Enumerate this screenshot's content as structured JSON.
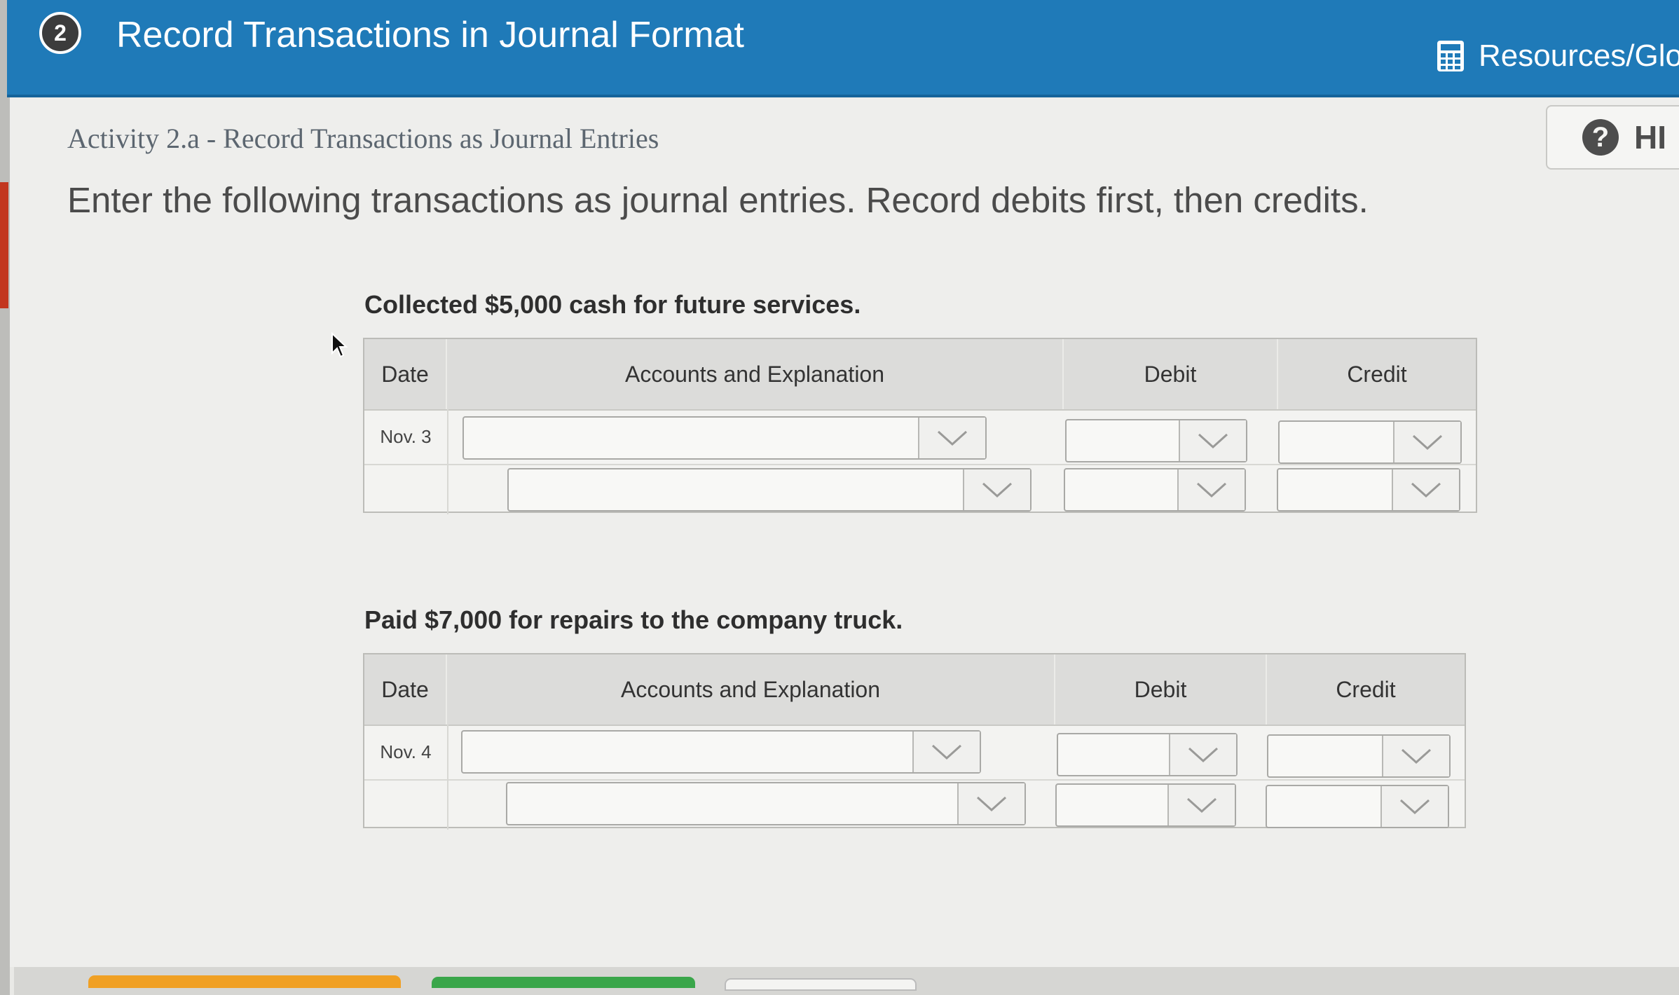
{
  "header": {
    "step_number": "2",
    "title": "Record Transactions in Journal Format",
    "resources_label": "Resources/Glos",
    "accent_color": "#1f7ab8"
  },
  "hint": {
    "icon": "question-circle-icon",
    "label": "HI"
  },
  "activity": {
    "subtitle": "Activity 2.a - Record Transactions as Journal Entries",
    "instructions": "Enter the following transactions as journal entries. Record debits first, then credits."
  },
  "journal_headers": {
    "date": "Date",
    "accounts": "Accounts and Explanation",
    "debit": "Debit",
    "credit": "Credit"
  },
  "transactions": [
    {
      "description": "Collected $5,000 cash for future services.",
      "rows": [
        {
          "date": "Nov. 3",
          "account": "",
          "debit": "",
          "credit": ""
        },
        {
          "date": "",
          "account": "",
          "debit": "",
          "credit": ""
        }
      ]
    },
    {
      "description": "Paid $7,000 for repairs to the company truck.",
      "rows": [
        {
          "date": "Nov. 4",
          "account": "",
          "debit": "",
          "credit": ""
        },
        {
          "date": "",
          "account": "",
          "debit": "",
          "credit": ""
        }
      ]
    }
  ]
}
